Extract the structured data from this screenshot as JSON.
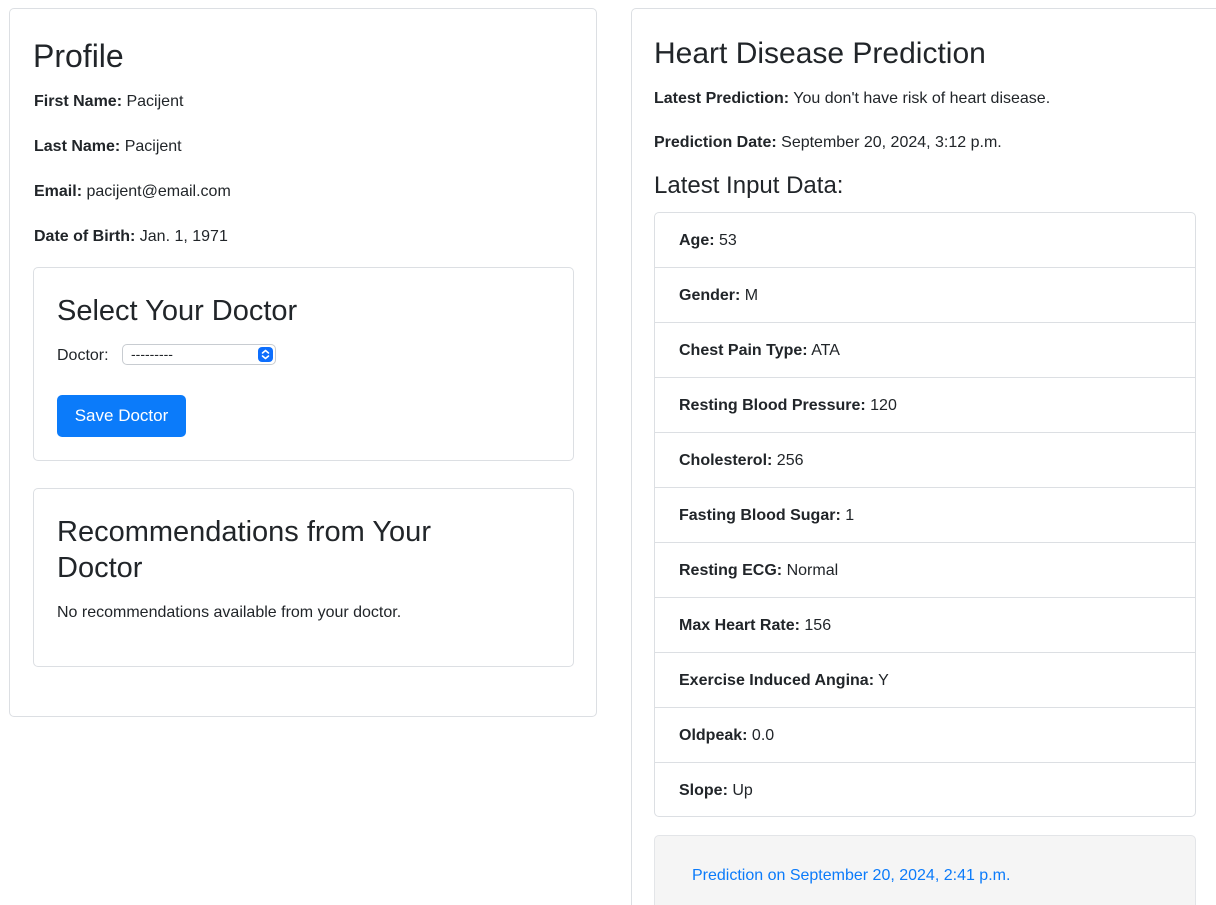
{
  "profile": {
    "title": "Profile",
    "fields": [
      {
        "label": "First Name:",
        "value": "Pacijent"
      },
      {
        "label": "Last Name:",
        "value": "Pacijent"
      },
      {
        "label": "Email:",
        "value": "pacijent@email.com"
      },
      {
        "label": "Date of Birth:",
        "value": "Jan. 1, 1971"
      }
    ],
    "doctor_section": {
      "title": "Select Your Doctor",
      "doctor_label": "Doctor:",
      "doctor_selected": "---------",
      "save_label": "Save Doctor"
    },
    "recommendations": {
      "title_line1": "Recommendations from Your",
      "title_line2": "Doctor",
      "empty_text": "No recommendations available from your doctor."
    }
  },
  "prediction": {
    "title": "Heart Disease Prediction",
    "latest_prediction_label": "Latest Prediction:",
    "latest_prediction_value": "You don't have risk of heart disease.",
    "prediction_date_label": "Prediction Date:",
    "prediction_date_value": "September 20, 2024, 3:12 p.m.",
    "input_title": "Latest Input Data:",
    "inputs": [
      {
        "label": "Age:",
        "value": "53"
      },
      {
        "label": "Gender:",
        "value": "M"
      },
      {
        "label": "Chest Pain Type:",
        "value": "ATA"
      },
      {
        "label": "Resting Blood Pressure:",
        "value": "120"
      },
      {
        "label": "Cholesterol:",
        "value": "256"
      },
      {
        "label": "Fasting Blood Sugar:",
        "value": "1"
      },
      {
        "label": "Resting ECG:",
        "value": "Normal"
      },
      {
        "label": "Max Heart Rate:",
        "value": "156"
      },
      {
        "label": "Exercise Induced Angina:",
        "value": "Y"
      },
      {
        "label": "Oldpeak:",
        "value": "0.0"
      },
      {
        "label": "Slope:",
        "value": "Up"
      }
    ],
    "history_link": "Prediction on September 20, 2024, 2:41 p.m."
  },
  "colors": {
    "primary": "#0b7bfa",
    "border": "#dcdfe3",
    "history_bg": "#f5f5f5"
  }
}
